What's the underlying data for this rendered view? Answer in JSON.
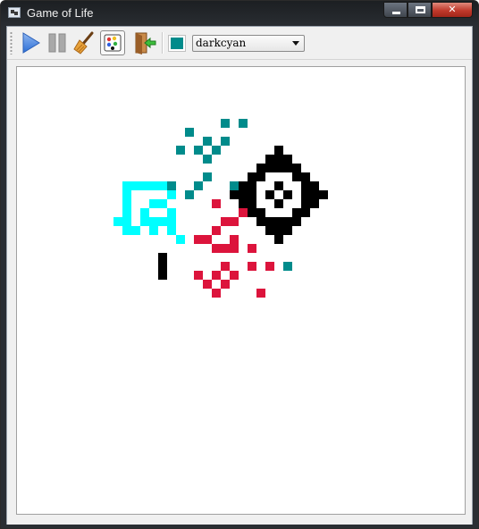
{
  "window": {
    "title": "Game of Life",
    "caption_buttons": {
      "minimize": "minimize-icon",
      "maximize": "maximize-icon",
      "close": "close-icon"
    }
  },
  "toolbar": {
    "buttons": [
      {
        "name": "play-button",
        "icon": "play-icon",
        "active": false
      },
      {
        "name": "pause-button",
        "icon": "pause-icon",
        "active": false
      },
      {
        "name": "clear-button",
        "icon": "broom-icon",
        "active": false
      },
      {
        "name": "palette-button",
        "icon": "palette-icon",
        "active": true
      },
      {
        "name": "exit-button",
        "icon": "exit-door-icon",
        "active": false
      }
    ],
    "color_select": {
      "selected": "darkcyan",
      "swatch_color": "#008b8b"
    }
  },
  "board": {
    "colors": {
      "darkcyan": "#008b8b",
      "cyan": "#00ffff",
      "crimson": "#dc143c",
      "black": "#000000"
    },
    "cells": {
      "darkcyan": [
        [
          23,
          6
        ],
        [
          25,
          6
        ],
        [
          19,
          7
        ],
        [
          21,
          8
        ],
        [
          23,
          8
        ],
        [
          18,
          9
        ],
        [
          20,
          9
        ],
        [
          22,
          9
        ],
        [
          21,
          10
        ],
        [
          21,
          12
        ],
        [
          17,
          13
        ],
        [
          20,
          13
        ],
        [
          24,
          13
        ],
        [
          19,
          14
        ],
        [
          30,
          22
        ]
      ],
      "cyan": [
        [
          12,
          13
        ],
        [
          13,
          13
        ],
        [
          14,
          13
        ],
        [
          15,
          13
        ],
        [
          16,
          13
        ],
        [
          12,
          14
        ],
        [
          17,
          14
        ],
        [
          12,
          15
        ],
        [
          15,
          15
        ],
        [
          16,
          15
        ],
        [
          12,
          16
        ],
        [
          14,
          16
        ],
        [
          17,
          16
        ],
        [
          11,
          17
        ],
        [
          12,
          17
        ],
        [
          14,
          17
        ],
        [
          15,
          17
        ],
        [
          16,
          17
        ],
        [
          17,
          17
        ],
        [
          12,
          18
        ],
        [
          13,
          18
        ],
        [
          15,
          18
        ],
        [
          17,
          18
        ],
        [
          18,
          19
        ]
      ],
      "crimson": [
        [
          22,
          15
        ],
        [
          25,
          16
        ],
        [
          23,
          17
        ],
        [
          24,
          17
        ],
        [
          27,
          17
        ],
        [
          22,
          18
        ],
        [
          20,
          19
        ],
        [
          21,
          19
        ],
        [
          24,
          19
        ],
        [
          23,
          20
        ],
        [
          24,
          20
        ],
        [
          22,
          20
        ],
        [
          26,
          20
        ],
        [
          23,
          22
        ],
        [
          26,
          22
        ],
        [
          28,
          22
        ],
        [
          20,
          23
        ],
        [
          22,
          23
        ],
        [
          24,
          23
        ],
        [
          21,
          24
        ],
        [
          23,
          24
        ],
        [
          22,
          25
        ],
        [
          27,
          25
        ]
      ],
      "black": [
        [
          29,
          9
        ],
        [
          28,
          10
        ],
        [
          29,
          10
        ],
        [
          30,
          10
        ],
        [
          27,
          11
        ],
        [
          28,
          11
        ],
        [
          29,
          11
        ],
        [
          30,
          11
        ],
        [
          31,
          11
        ],
        [
          26,
          12
        ],
        [
          27,
          12
        ],
        [
          31,
          12
        ],
        [
          32,
          12
        ],
        [
          25,
          13
        ],
        [
          26,
          13
        ],
        [
          29,
          13
        ],
        [
          32,
          13
        ],
        [
          33,
          13
        ],
        [
          24,
          14
        ],
        [
          25,
          14
        ],
        [
          26,
          14
        ],
        [
          28,
          14
        ],
        [
          30,
          14
        ],
        [
          32,
          14
        ],
        [
          33,
          14
        ],
        [
          34,
          14
        ],
        [
          25,
          15
        ],
        [
          26,
          15
        ],
        [
          29,
          15
        ],
        [
          32,
          15
        ],
        [
          33,
          15
        ],
        [
          26,
          16
        ],
        [
          27,
          16
        ],
        [
          31,
          16
        ],
        [
          32,
          16
        ],
        [
          27,
          17
        ],
        [
          28,
          17
        ],
        [
          29,
          17
        ],
        [
          30,
          17
        ],
        [
          31,
          17
        ],
        [
          28,
          18
        ],
        [
          29,
          18
        ],
        [
          30,
          18
        ],
        [
          29,
          19
        ],
        [
          16,
          21
        ],
        [
          16,
          22
        ],
        [
          16,
          23
        ]
      ]
    }
  }
}
